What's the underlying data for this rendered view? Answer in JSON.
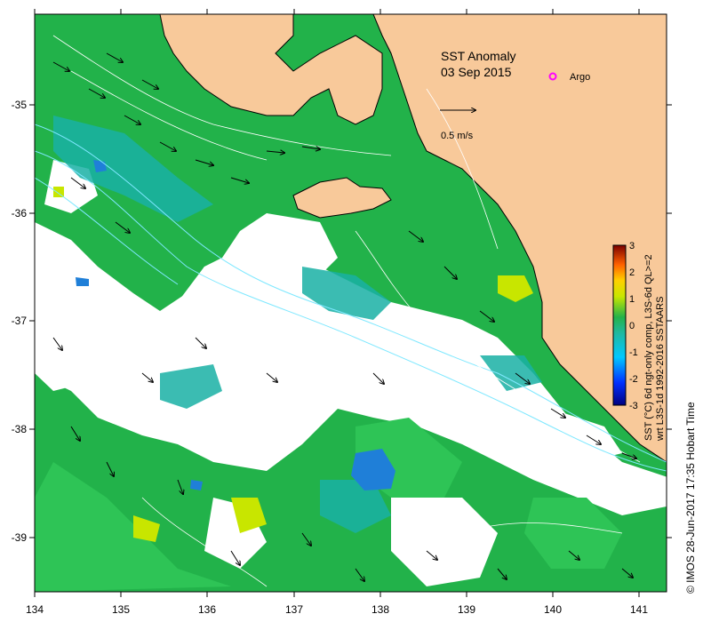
{
  "title": "SST Anomaly",
  "date": "03 Sep 2015",
  "legend": {
    "argo_label": "Argo",
    "vector_scale": "0.5 m/s"
  },
  "axes": {
    "x_ticks": [
      "134",
      "135",
      "136",
      "137",
      "138",
      "139",
      "140",
      "141"
    ],
    "y_ticks": [
      "-35",
      "-36",
      "-37",
      "-38",
      "-39"
    ]
  },
  "colorbar": {
    "ticks": [
      "3",
      "2",
      "1",
      "0",
      "-1",
      "-2",
      "-3"
    ],
    "label_line1": "SST (°C) 6d ngt-only comp, L3S-6d QL>=2",
    "label_line2": "wrt L3S-1d 1992-2016 SSTAARS"
  },
  "credit": "© IMOS 28-Jun-2017 17:35 Hobart Time",
  "colors": {
    "land": "#f8c99a",
    "ocean_main": "#22b24a",
    "ocean_light": "#2ec456",
    "teal": "#19b0a4",
    "cyan_contour": "#7fe8ff",
    "argo": "#ff00ff"
  }
}
